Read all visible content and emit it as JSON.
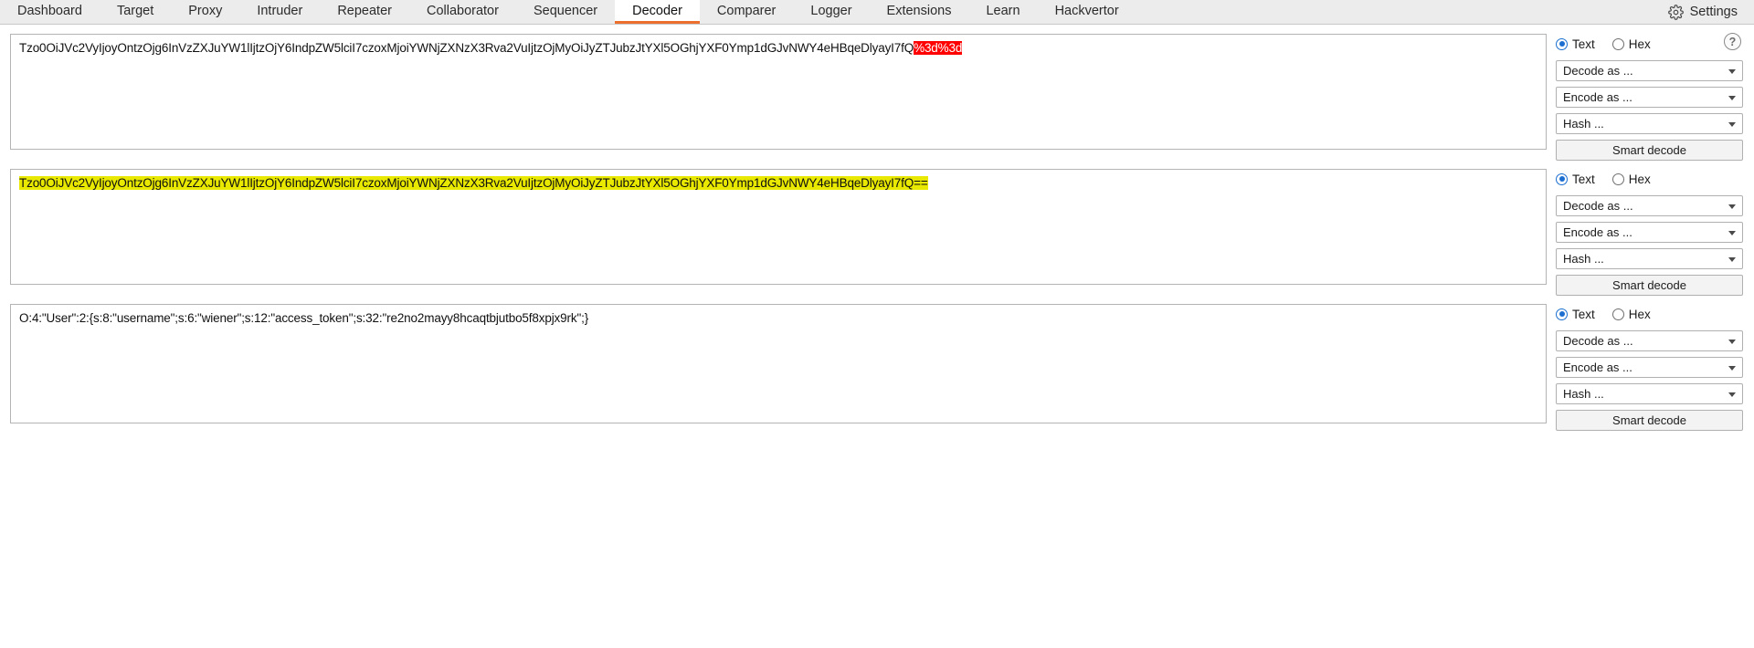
{
  "tabbar": {
    "tabs": [
      {
        "label": "Dashboard",
        "active": false
      },
      {
        "label": "Target",
        "active": false
      },
      {
        "label": "Proxy",
        "active": false
      },
      {
        "label": "Intruder",
        "active": false
      },
      {
        "label": "Repeater",
        "active": false
      },
      {
        "label": "Collaborator",
        "active": false
      },
      {
        "label": "Sequencer",
        "active": false
      },
      {
        "label": "Decoder",
        "active": true
      },
      {
        "label": "Comparer",
        "active": false
      },
      {
        "label": "Logger",
        "active": false
      },
      {
        "label": "Extensions",
        "active": false
      },
      {
        "label": "Learn",
        "active": false
      },
      {
        "label": "Hackvertor",
        "active": false
      }
    ],
    "settings_label": "Settings",
    "active_tab_accent": "#ec6f2d"
  },
  "controls": {
    "text_label": "Text",
    "hex_label": "Hex",
    "help_glyph": "?",
    "decode_as": "Decode as ...",
    "encode_as": "Encode as ...",
    "hash": "Hash ...",
    "smart_decode": "Smart decode"
  },
  "panels": [
    {
      "name": "input",
      "text_plain": "Tzo0OiJVc2VyIjoyOntzOjg6InVzZXJuYW1lIjtzOjY6IndpZW5lciI7czoxMjoiYWNjZXNzX3Rva2VuIjtzOjMyOiJyZTJubzJtYXl5OGhjYXF0Ymp1dGJvNWY4eHBqeDlyayI7fQ",
      "highlight_text": "%3d%3d",
      "highlight_color": "#fe0000",
      "highlight_text_color": "#ffffff",
      "selected_format": "Text"
    },
    {
      "name": "url-decoded",
      "text_plain": "",
      "highlight_text": "Tzo0OiJVc2VyIjoyOntzOjg6InVzZXJuYW1lIjtzOjY6IndpZW5lciI7czoxMjoiYWNjZXNzX3Rva2VuIjtzOjMyOiJyZTJubzJtYXl5OGhjYXF0Ymp1dGJvNWY4eHBqeDlyayI7fQ==",
      "highlight_color": "#e8e800",
      "highlight_text_color": "#111111",
      "selected_format": "Text"
    },
    {
      "name": "base64-decoded",
      "text_plain": "O:4:\"User\":2:{s:8:\"username\";s:6:\"wiener\";s:12:\"access_token\";s:32:\"re2no2mayy8hcaqtbjutbo5f8xpjx9rk\";}",
      "highlight_text": "",
      "highlight_color": "",
      "highlight_text_color": "",
      "selected_format": "Text"
    }
  ]
}
